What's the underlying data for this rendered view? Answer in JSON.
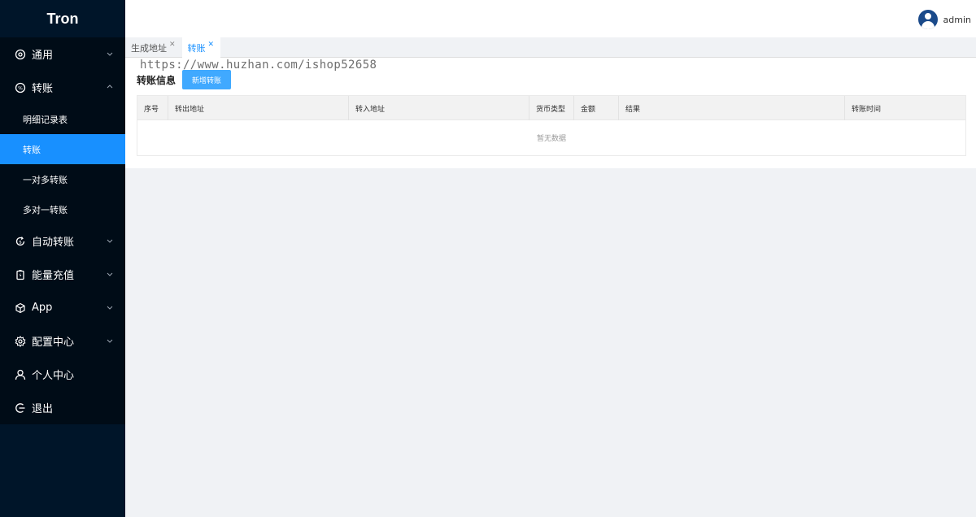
{
  "app": {
    "title": "Tron"
  },
  "watermark": "https://www.huzhan.com/ishop52658",
  "sidebar": {
    "items": [
      {
        "label": "通用",
        "icon": "target-icon",
        "expandable": true,
        "expanded": false
      },
      {
        "label": "转账",
        "icon": "coin-icon",
        "expandable": true,
        "expanded": true,
        "children": [
          {
            "label": "明细记录表",
            "active": false
          },
          {
            "label": "转账",
            "active": true
          },
          {
            "label": "一对多转账",
            "active": false
          },
          {
            "label": "多对一转账",
            "active": false
          }
        ]
      },
      {
        "label": "自动转账",
        "icon": "sync-icon",
        "expandable": true,
        "expanded": false
      },
      {
        "label": "能量充值",
        "icon": "battery-icon",
        "expandable": true,
        "expanded": false
      },
      {
        "label": "App",
        "icon": "cube-icon",
        "expandable": true,
        "expanded": false
      },
      {
        "label": "配置中心",
        "icon": "gear-icon",
        "expandable": true,
        "expanded": false
      },
      {
        "label": "个人中心",
        "icon": "user-icon",
        "expandable": false
      },
      {
        "label": "退出",
        "icon": "logout-icon",
        "expandable": false
      }
    ]
  },
  "header": {
    "username": "admin"
  },
  "tabs": [
    {
      "label": "生成地址",
      "active": false
    },
    {
      "label": "转账",
      "active": true
    }
  ],
  "main": {
    "title": "转账信息",
    "add_button": "新增转账",
    "table": {
      "columns": [
        "序号",
        "转出地址",
        "转入地址",
        "货币类型",
        "金额",
        "结果",
        "转账时间"
      ],
      "empty_text": "暂无数据"
    }
  },
  "colors": {
    "sidebar_bg": "#001529",
    "accent": "#1890ff"
  }
}
